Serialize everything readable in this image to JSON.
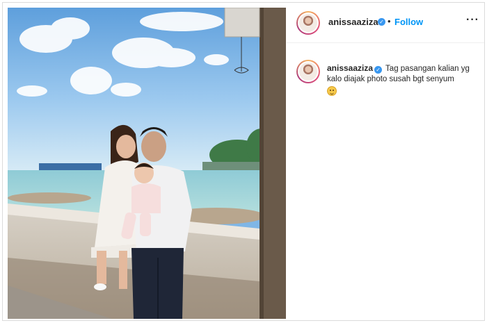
{
  "post": {
    "username": "anissaaziza",
    "separator": "•",
    "follow_label": "Follow",
    "more_label": "···",
    "verified_mark": "✓",
    "caption_username": "anissaaziza",
    "caption_text": "Tag pasangan kalian yg kalo diajak photo susah bgt senyum",
    "caption_emoji": "grinning-sweat-face-emoji"
  },
  "photo": {
    "subject": "family-photo",
    "sky_color": "#7fb6e6",
    "sea_color": "#a9d6da"
  },
  "colors": {
    "accent": "#0095f6",
    "verified": "#3897f0",
    "text": "#262626",
    "border": "#dbdbdb"
  }
}
